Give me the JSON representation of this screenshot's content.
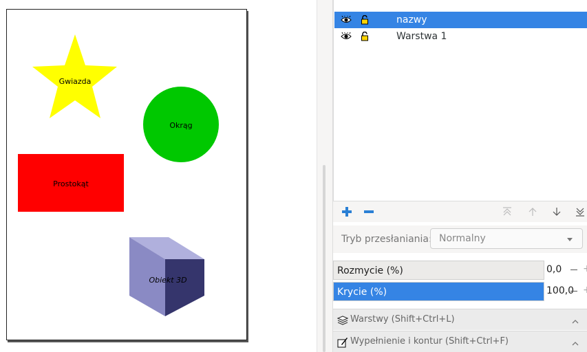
{
  "canvas": {
    "shapes": [
      {
        "name": "star",
        "label": "Gwiazda",
        "color": "#ffff00"
      },
      {
        "name": "circle",
        "label": "Okrąg",
        "color": "#00c800"
      },
      {
        "name": "rect",
        "label": "Prostokąt",
        "color": "#ff0000"
      },
      {
        "name": "box3d",
        "label": "Obiekt 3D",
        "colors": {
          "top": "#b0b0dd",
          "left": "#8a8ac4",
          "right": "#35356c"
        }
      }
    ]
  },
  "layers": {
    "items": [
      {
        "name": "nazwy",
        "selected": true,
        "visible": true,
        "locked": false
      },
      {
        "name": "Warstwa 1",
        "selected": false,
        "visible": true,
        "locked": false
      }
    ],
    "toolbar": {
      "icons": [
        "add-layer-icon",
        "remove-layer-icon",
        "raise-to-top-icon",
        "raise-icon",
        "lower-icon",
        "lower-to-bottom-icon"
      ]
    },
    "blend": {
      "label": "Tryb przesłaniania:",
      "value": "Normalny"
    },
    "blur": {
      "label": "Rozmycie (%)",
      "value": "0,0",
      "percent": 0
    },
    "opacity": {
      "label": "Krycie (%)",
      "value": "100,0",
      "percent": 100
    }
  },
  "dock": {
    "layers_header": "Warstwy (Shift+Ctrl+L)",
    "fill_header": "Wypełnienie i kontur (Shift+Ctrl+F)"
  },
  "colors": {
    "accent": "#3584e4"
  }
}
